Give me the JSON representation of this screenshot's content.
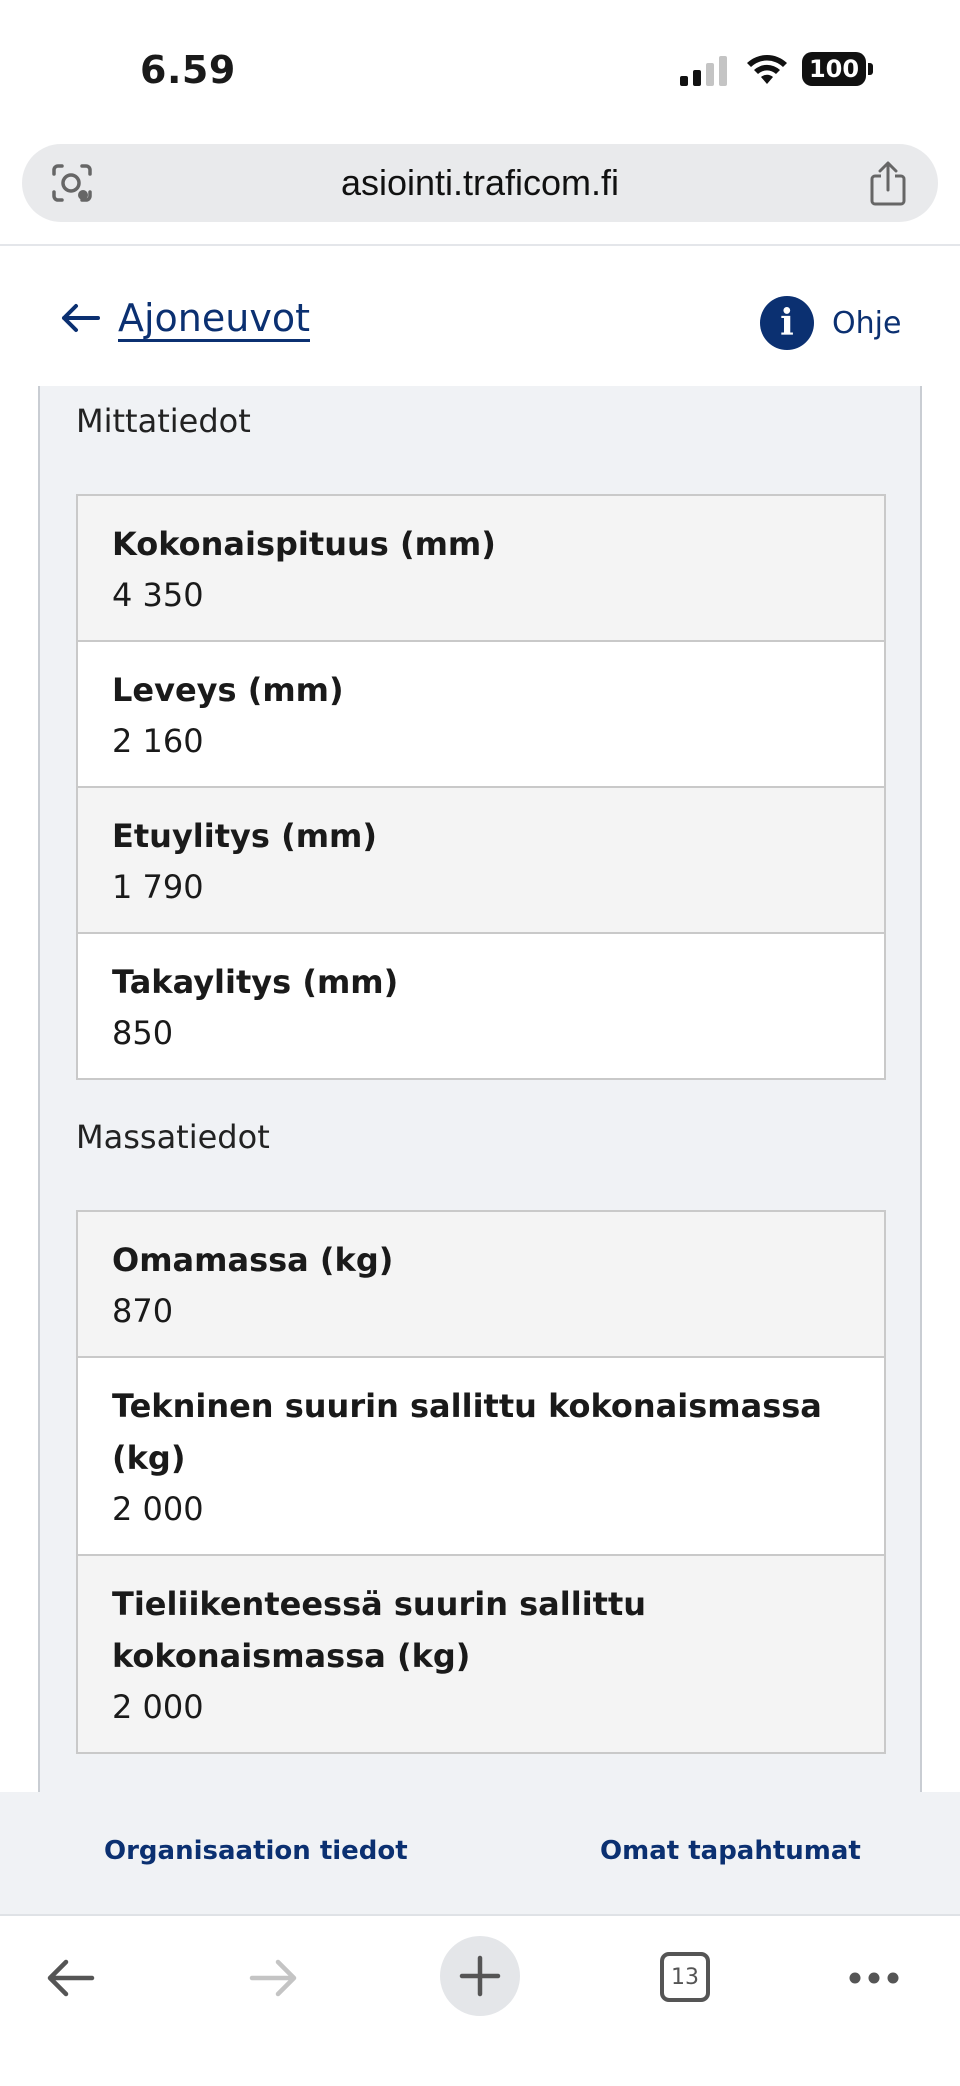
{
  "status_bar": {
    "time": "6.59",
    "battery": "100"
  },
  "url_bar": {
    "url": "asiointi.traficom.fi"
  },
  "header": {
    "back_label": "Ajoneuvot",
    "help_label": "Ohje",
    "help_icon_glyph": "i"
  },
  "sections": {
    "dimensions": {
      "title": "Mittatiedot",
      "rows": [
        {
          "label": "Kokonaispituus (mm)",
          "value": "4 350"
        },
        {
          "label": "Leveys (mm)",
          "value": "2 160"
        },
        {
          "label": "Etuylitys (mm)",
          "value": "1 790"
        },
        {
          "label": "Takaylitys (mm)",
          "value": "850"
        }
      ]
    },
    "masses": {
      "title": "Massatiedot",
      "rows": [
        {
          "label": "Omamassa (kg)",
          "value": "870"
        },
        {
          "label": "Tekninen suurin sallittu kokonaismassa (kg)",
          "value": "2 000"
        },
        {
          "label": "Tieliikenteessä suurin sallittu kokonaismassa (kg)",
          "value": "2 000"
        }
      ]
    }
  },
  "footer": {
    "left_link": "Organisaation tiedot",
    "right_link": "Omat tapahtumat"
  },
  "toolbar": {
    "tab_count": "13"
  },
  "icons": {
    "status": [
      "signal-icon",
      "wifi-icon",
      "battery-icon"
    ],
    "url_bar": [
      "lens-icon",
      "share-icon"
    ],
    "header": [
      "back-arrow-icon",
      "info-icon"
    ],
    "toolbar": [
      "back-icon",
      "forward-icon",
      "plus-icon",
      "tabs-icon",
      "more-icon"
    ]
  },
  "colors": {
    "brand_blue": "#0b3071",
    "panel_bg": "#f0f2f5",
    "row_shade": "#f4f4f4"
  }
}
